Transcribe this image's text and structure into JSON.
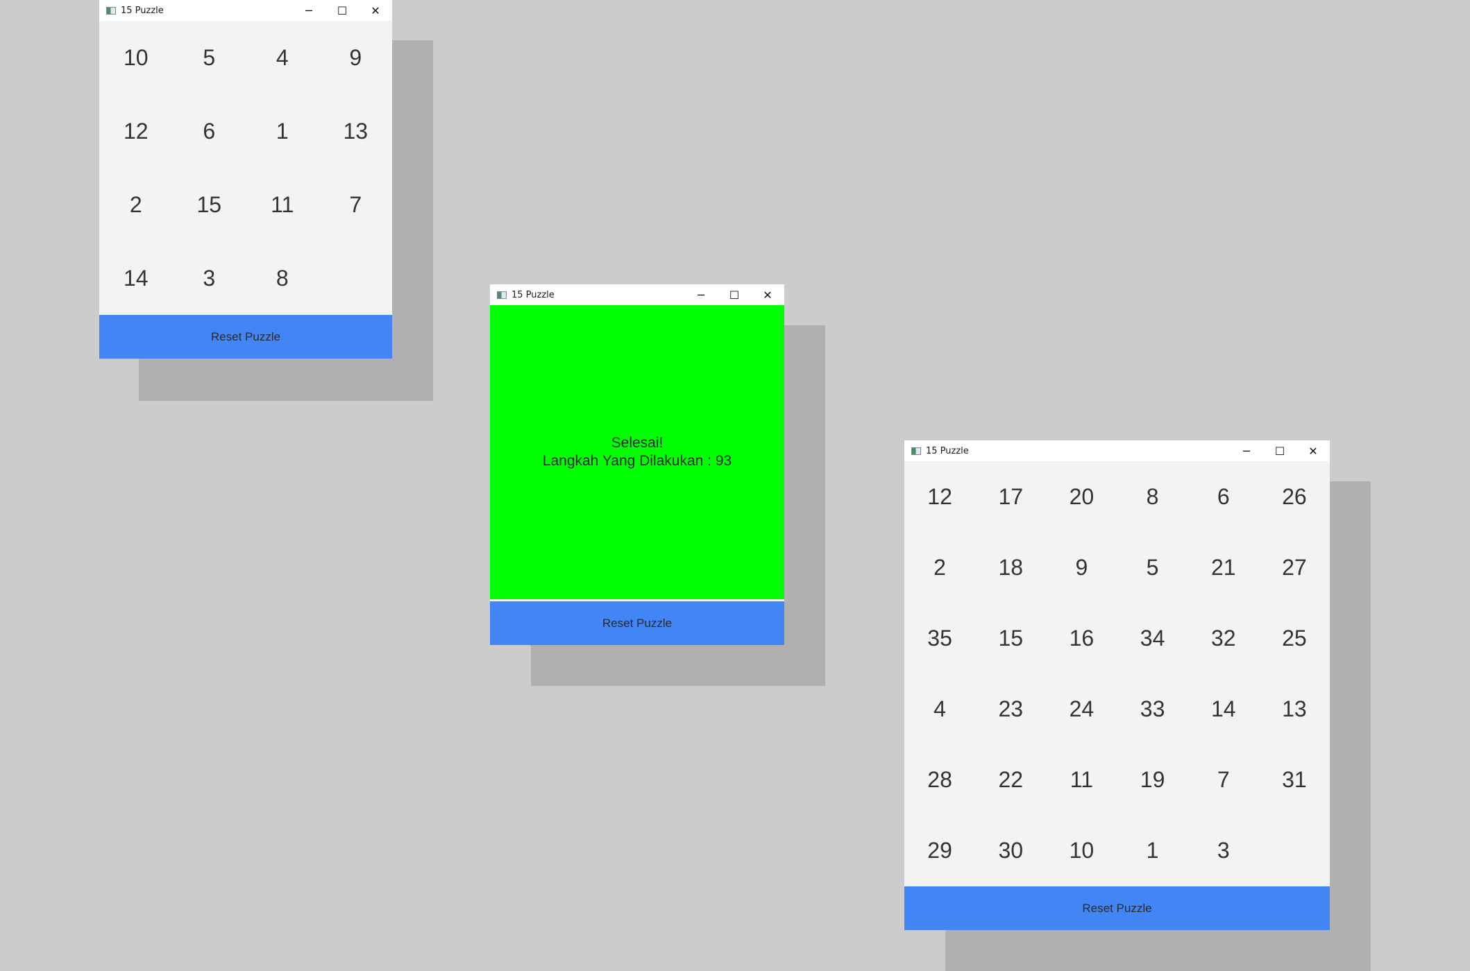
{
  "window_title": "15 Puzzle",
  "controls": {
    "minimize": "─",
    "maximize": "☐",
    "close": "✕"
  },
  "reset_label": "Reset Puzzle",
  "colors": {
    "background": "#cccccc",
    "shadow": "#b0b0b0",
    "board": "#f3f3f3",
    "reset_button": "#4285f4",
    "solved": "#00ff00"
  },
  "puzzle_4x4": {
    "tiles": [
      "10",
      "5",
      "4",
      "9",
      "12",
      "6",
      "1",
      "13",
      "2",
      "15",
      "11",
      "7",
      "14",
      "3",
      "8",
      ""
    ]
  },
  "solved_window": {
    "line1": "Selesai!",
    "line2": "Langkah Yang Dilakukan : 93"
  },
  "puzzle_6x6": {
    "tiles": [
      "12",
      "17",
      "20",
      "8",
      "6",
      "26",
      "2",
      "18",
      "9",
      "5",
      "21",
      "27",
      "35",
      "15",
      "16",
      "34",
      "32",
      "25",
      "4",
      "23",
      "24",
      "33",
      "14",
      "13",
      "28",
      "22",
      "11",
      "19",
      "7",
      "31",
      "29",
      "30",
      "10",
      "1",
      "3",
      ""
    ]
  }
}
